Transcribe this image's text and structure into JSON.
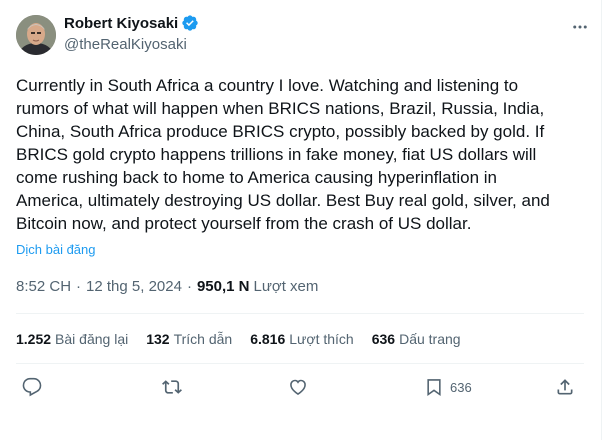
{
  "author": {
    "name": "Robert Kiyosaki",
    "handle": "@theRealKiyosaki",
    "verified": true,
    "verified_color": "#1d9bf0"
  },
  "tweet": {
    "text": "Currently in South Africa a country I love. Watching and listening to\nrumors of what will happen when BRICS nations, Brazil, Russia, India,\nChina, South Africa produce BRICS crypto, possibly backed by gold. If\nBRICS gold crypto happens trillions in fake money, fiat US dollars will\ncome rushing back to home to America causing hyperinflation in\nAmerica, ultimately destroying US dollar. Best Buy real gold, silver, and\nBitcoin now, and protect yourself from the crash of US dollar.",
    "translate_label": "Dịch bài đăng"
  },
  "meta": {
    "time": "8:52 CH",
    "date": "12 thg 5, 2024",
    "separator": "·",
    "views_count": "950,1 N",
    "views_label": "Lượt xem"
  },
  "stats": {
    "reposts_count": "1.252",
    "reposts_label": "Bài đăng lại",
    "quotes_count": "132",
    "quotes_label": "Trích dẫn",
    "likes_count": "6.816",
    "likes_label": "Lượt thích",
    "bookmarks_count": "636",
    "bookmarks_label": "Dấu trang"
  },
  "actions": {
    "reply_icon": "reply-icon",
    "repost_icon": "repost-icon",
    "like_icon": "heart-icon",
    "bookmark_icon": "bookmark-icon",
    "bookmark_count": "636",
    "share_icon": "share-icon"
  },
  "colors": {
    "text": "#0f1419",
    "secondary": "#536471",
    "link": "#1d9bf0",
    "divider": "#eff3f4"
  }
}
